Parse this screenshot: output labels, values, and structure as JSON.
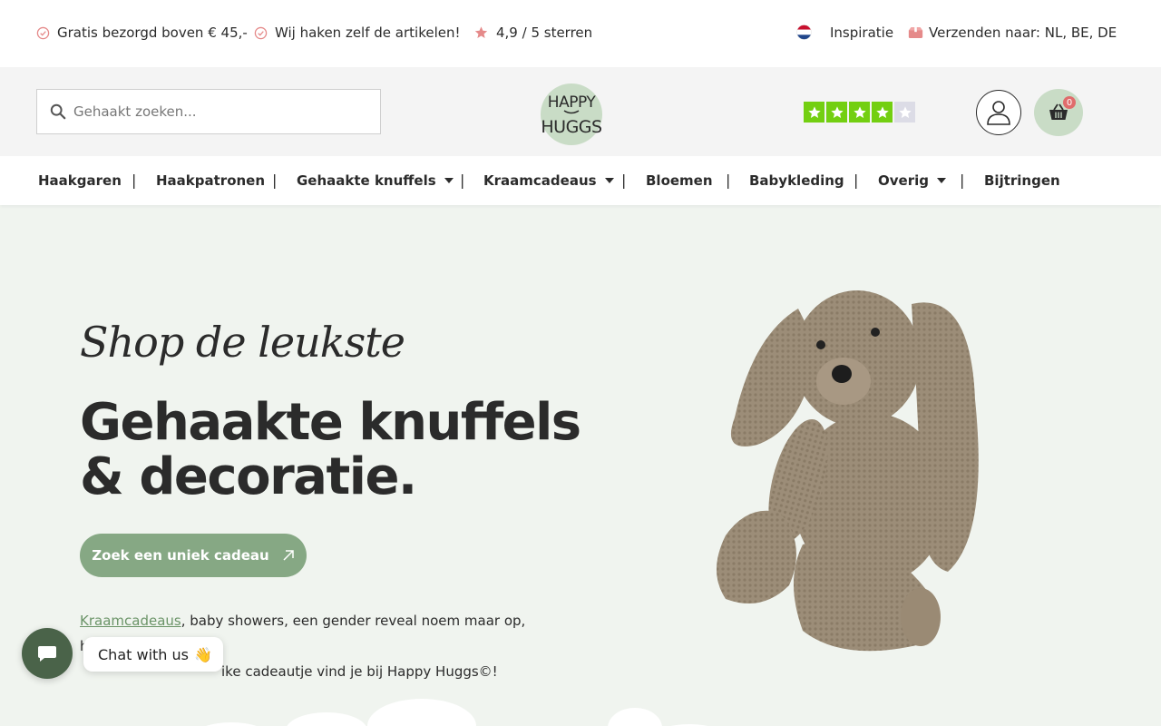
{
  "topbar": {
    "usps": [
      {
        "label": "Gratis bezorgd boven € 45,-",
        "icon": "check-circle-icon"
      },
      {
        "label": "Wij haken zelf de artikelen!",
        "icon": "check-circle-icon"
      },
      {
        "label": "4,9 / 5 sterren",
        "icon": "star-icon"
      }
    ],
    "inspiration_label": "Inspiratie",
    "shipping_label": "Verzenden naar: NL, BE, DE",
    "accent_color": "#e58a8a"
  },
  "header": {
    "search_placeholder": "Gehaakt zoeken...",
    "logo_text_line1": "HAPPY",
    "logo_text_line2": "HUGGS",
    "trustpilot_stars": 4,
    "cart_count": "0"
  },
  "nav": {
    "items": [
      {
        "label": "Haakgaren",
        "dropdown": false
      },
      {
        "label": "Haakpatronen",
        "dropdown": false
      },
      {
        "label": "Gehaakte knuffels",
        "dropdown": true
      },
      {
        "label": "Kraamcadeaus",
        "dropdown": true
      },
      {
        "label": "Bloemen",
        "dropdown": false
      },
      {
        "label": "Babykleding",
        "dropdown": false
      },
      {
        "label": "Overig",
        "dropdown": true
      },
      {
        "label": "Bijtringen",
        "dropdown": false
      }
    ],
    "separator": "|"
  },
  "hero": {
    "tagline": "Shop de leukste",
    "headline_line1": "Gehaakte knuffels",
    "headline_line2": "& decoratie.",
    "cta_label": "Zoek een uniek cadeau",
    "desc_link": "Kraamcadeaus",
    "desc_line1_rest": ", baby showers, een gender reveal noem maar op, het",
    "desc_line2_visible": "ike cadeautje vind je bij Happy Huggs©!",
    "brand_color": "#86a884",
    "background_color": "#f0f4ef"
  },
  "chat": {
    "label": "Chat with us",
    "emoji": "👋"
  }
}
